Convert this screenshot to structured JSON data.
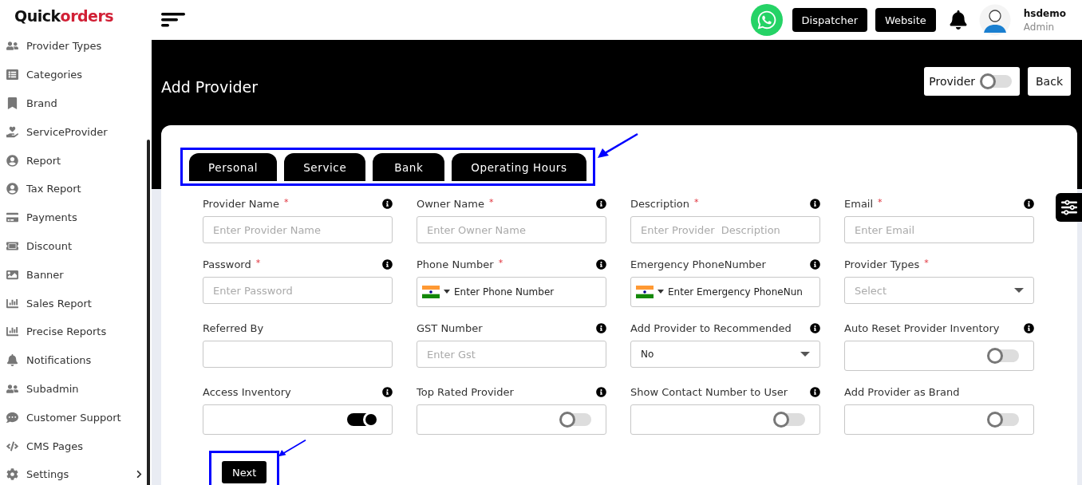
{
  "brand": {
    "first": "Quick",
    "second": "orders"
  },
  "sidebar": {
    "items": [
      {
        "label": "Provider Types"
      },
      {
        "label": "Categories"
      },
      {
        "label": "Brand"
      },
      {
        "label": "ServiceProvider"
      },
      {
        "label": "Report"
      },
      {
        "label": "Tax Report"
      },
      {
        "label": "Payments"
      },
      {
        "label": "Discount"
      },
      {
        "label": "Banner"
      },
      {
        "label": "Sales Report"
      },
      {
        "label": "Precise Reports"
      },
      {
        "label": "Notifications"
      },
      {
        "label": "Subadmin"
      },
      {
        "label": "Customer Support"
      },
      {
        "label": "CMS Pages"
      },
      {
        "label": "Settings",
        "has_submenu": true
      }
    ]
  },
  "topbar": {
    "buttons": [
      "Dispatcher",
      "Website"
    ],
    "user": {
      "name": "hsdemo",
      "role": "Admin"
    }
  },
  "page": {
    "title": "Add Provider",
    "provider_toggle": {
      "label": "Provider",
      "on": false
    },
    "back": "Back"
  },
  "tabs": [
    {
      "label": "Personal"
    },
    {
      "label": "Service"
    },
    {
      "label": "Bank"
    },
    {
      "label": "Operating Hours"
    }
  ],
  "fields": [
    {
      "kind": "text",
      "label": "Provider Name",
      "required_mark": "*",
      "info": true,
      "placeholder": "Enter Provider Name"
    },
    {
      "kind": "text",
      "label": "Owner Name",
      "required_mark": "*",
      "info": true,
      "placeholder": "Enter Owner Name"
    },
    {
      "kind": "text",
      "label": "Description",
      "required_mark": "*",
      "info": true,
      "placeholder": "Enter Provider  Description"
    },
    {
      "kind": "text",
      "label": "Email",
      "required_mark": "*",
      "info": true,
      "placeholder": "Enter Email"
    },
    {
      "kind": "text",
      "label": "Password",
      "required_mark": "*",
      "info": true,
      "placeholder": "Enter Password"
    },
    {
      "kind": "phone",
      "label": "Phone Number",
      "required_mark": "*",
      "info": true,
      "placeholder": "Enter Phone Number"
    },
    {
      "kind": "phone",
      "label": "Emergency PhoneNumber",
      "info": true,
      "placeholder": "Enter Emergency PhoneNun"
    },
    {
      "kind": "select",
      "label": "Provider Types",
      "required_mark": "*",
      "info": false,
      "placeholder": "Select"
    },
    {
      "kind": "text",
      "label": "Referred By",
      "info": false
    },
    {
      "kind": "text",
      "label": "GST Number",
      "info": true,
      "placeholder": "Enter Gst"
    },
    {
      "kind": "select",
      "label": "Add Provider to Recommended",
      "info": true,
      "value": "No"
    },
    {
      "kind": "toggle",
      "label": "Auto Reset Provider Inventory",
      "info": true,
      "on": false
    },
    {
      "kind": "toggle",
      "label": "Access Inventory",
      "info": true,
      "on": true
    },
    {
      "kind": "toggle",
      "label": "Top Rated Provider",
      "info": true,
      "on": false
    },
    {
      "kind": "toggle",
      "label": "Show Contact Number to User",
      "info": true,
      "on": false
    },
    {
      "kind": "toggle",
      "label": "Add Provider as Brand",
      "info": false,
      "on": false
    }
  ],
  "next": "Next"
}
